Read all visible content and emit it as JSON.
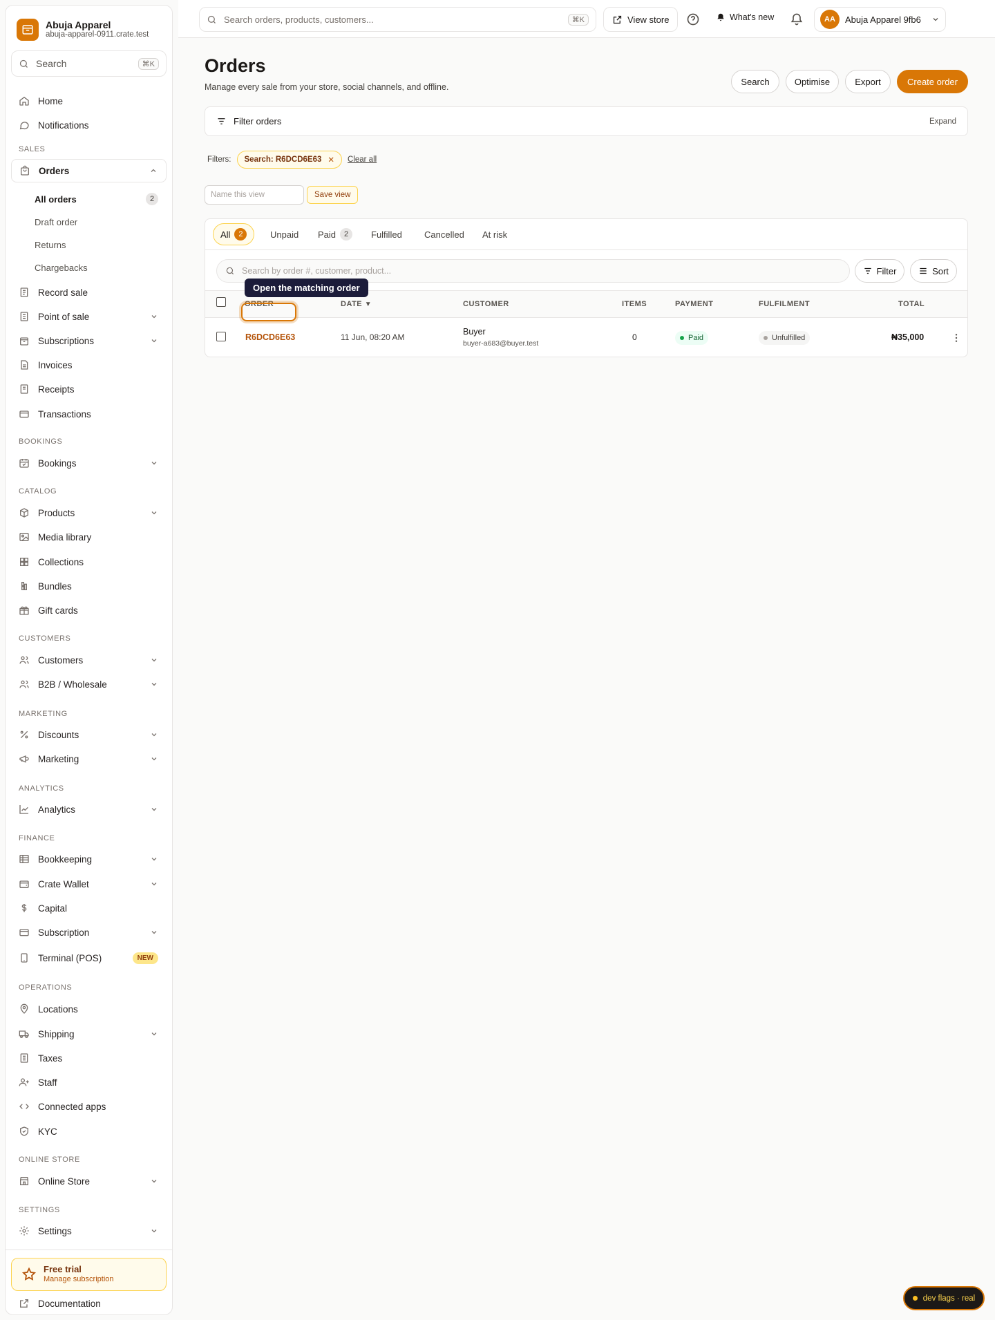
{
  "brand": {
    "name": "Abuja Apparel",
    "url": "abuja-apparel-0911.crate.test"
  },
  "sidebar": {
    "search_label": "Search",
    "search_shortcut": "⌘K",
    "items": {
      "home": "Home",
      "notifications": "Notifications",
      "orders": "Orders",
      "record_sale": "Record sale",
      "point_of_sale": "Point of sale",
      "subscriptions": "Subscriptions",
      "invoices": "Invoices",
      "receipts": "Receipts",
      "transactions": "Transactions",
      "bookings": "Bookings",
      "products": "Products",
      "media_library": "Media library",
      "collections": "Collections",
      "bundles": "Bundles",
      "gift_cards": "Gift cards",
      "customers": "Customers",
      "b2b": "B2B / Wholesale",
      "discounts": "Discounts",
      "marketing": "Marketing",
      "analytics": "Analytics",
      "bookkeeping": "Bookkeeping",
      "crate_wallet": "Crate Wallet",
      "capital": "Capital",
      "subscription": "Subscription",
      "terminal": "Terminal (POS)",
      "locations": "Locations",
      "shipping": "Shipping",
      "taxes": "Taxes",
      "staff": "Staff",
      "connected_apps": "Connected apps",
      "kyc": "KYC",
      "online_store": "Online Store",
      "settings": "Settings",
      "documentation": "Documentation"
    },
    "orders_sub": {
      "all_orders": "All orders",
      "all_orders_count": "2",
      "draft_order": "Draft order",
      "returns": "Returns",
      "chargebacks": "Chargebacks"
    },
    "sections": {
      "sales": "SALES",
      "bookings": "BOOKINGS",
      "catalog": "CATALOG",
      "customers": "CUSTOMERS",
      "marketing": "MARKETING",
      "analytics": "ANALYTICS",
      "finance": "FINANCE",
      "operations": "OPERATIONS",
      "online_store": "ONLINE STORE",
      "settings": "SETTINGS"
    },
    "new_badge": "NEW",
    "trial": {
      "title": "Free trial",
      "subtitle": "Manage subscription"
    }
  },
  "topbar": {
    "search_placeholder": "Search orders, products, customers...",
    "search_shortcut": "⌘K",
    "view_store": "View store",
    "whats_new": "What's new",
    "account_initials": "AA",
    "account_name": "Abuja Apparel 9fb6"
  },
  "page": {
    "title": "Orders",
    "subtitle": "Manage every sale from your store, social channels, and offline.",
    "actions": {
      "search": "Search",
      "optimise": "Optimise",
      "export": "Export",
      "create": "Create order"
    },
    "filter_panel": {
      "label": "Filter orders",
      "expand": "Expand"
    },
    "filters": {
      "label": "Filters:",
      "chip": "Search: R6DCD6E63",
      "clear": "Clear all"
    },
    "view": {
      "placeholder": "Name this view",
      "save": "Save view"
    }
  },
  "tabs": [
    {
      "label": "All",
      "count": "2"
    },
    {
      "label": "Unpaid",
      "count": null
    },
    {
      "label": "Paid",
      "count": "2"
    },
    {
      "label": "Fulfilled",
      "count": null
    },
    {
      "label": "Cancelled",
      "count": null
    },
    {
      "label": "At risk",
      "count": null
    }
  ],
  "table": {
    "search_placeholder": "Search by order #, customer, product...",
    "filter_label": "Filter",
    "sort_label": "Sort",
    "columns": {
      "order": "ORDER",
      "date": "DATE",
      "customer": "CUSTOMER",
      "items": "ITEMS",
      "payment": "PAYMENT",
      "fulfilment": "FULFILMENT",
      "total": "TOTAL"
    },
    "rows": [
      {
        "order": "R6DCD6E63",
        "date": "11 Jun, 08:20 AM",
        "customer_name": "Buyer",
        "customer_email": "buyer-a683@buyer.test",
        "items": "0",
        "payment": "Paid",
        "fulfilment": "Unfulfilled",
        "total": "₦35,000"
      }
    ]
  },
  "tooltip": "Open the matching order",
  "dev_flags": "dev flags · real",
  "colors": {
    "accent": "#d97706",
    "paid_green": "#16a34a",
    "tooltip_bg": "#1c1c3a"
  }
}
